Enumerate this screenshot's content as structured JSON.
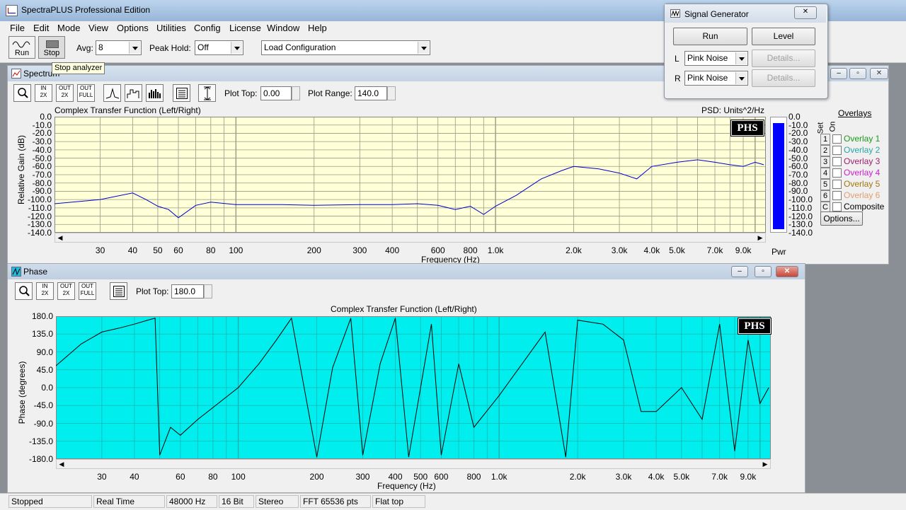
{
  "app": {
    "title": "SpectraPLUS Professional Edition"
  },
  "menu": [
    "File",
    "Edit",
    "Mode",
    "View",
    "Options",
    "Utilities",
    "Config",
    "License",
    "Window",
    "Help"
  ],
  "toolbar": {
    "run_label": "Run",
    "stop_label": "Stop",
    "avg_label": "Avg:",
    "avg_value": "8",
    "peak_hold_label": "Peak Hold:",
    "peak_hold_value": "Off",
    "load_config_value": "Load Configuration",
    "tooltip": "Stop analyzer"
  },
  "spectrum": {
    "title": "Spectrum",
    "plot_top_label": "Plot Top:",
    "plot_top_value": "0.00",
    "plot_range_label": "Plot Range:",
    "plot_range_value": "140.0",
    "chart_title": "Complex Transfer Function (Left/Right)",
    "psd_label": "PSD: Units^2/Hz",
    "y_axis_label": "Relative Gain (dB)",
    "x_axis_label": "Frequency (Hz)",
    "badge": "PHS",
    "pwr_label": "Pwr"
  },
  "overlays": {
    "header": "Overlays",
    "set_label": "Set",
    "on_label": "On",
    "items": [
      {
        "num": "1",
        "name": "Overlay 1",
        "color": "#1a9a1a"
      },
      {
        "num": "2",
        "name": "Overlay 2",
        "color": "#2aa7a7"
      },
      {
        "num": "3",
        "name": "Overlay 3",
        "color": "#a0206a"
      },
      {
        "num": "4",
        "name": "Overlay 4",
        "color": "#d020d0"
      },
      {
        "num": "5",
        "name": "Overlay 5",
        "color": "#a0780f"
      },
      {
        "num": "6",
        "name": "Overlay 6",
        "color": "#e0a070"
      },
      {
        "num": "C",
        "name": "Composite",
        "color": "#000000"
      }
    ],
    "options_label": "Options..."
  },
  "phase": {
    "title": "Phase",
    "plot_top_label": "Plot Top:",
    "plot_top_value": "180.0",
    "chart_title": "Complex Transfer Function (Left/Right)",
    "y_axis_label": "Phase (degrees)",
    "x_axis_label": "Frequency (Hz)",
    "badge": "PHS"
  },
  "signal_generator": {
    "title": "Signal Generator",
    "run_label": "Run",
    "level_label": "Level",
    "left_label": "L",
    "right_label": "R",
    "left_value": "Pink Noise",
    "right_value": "Pink Noise",
    "details_label": "Details..."
  },
  "status": {
    "state": "Stopped",
    "mode": "Real Time",
    "rate": "48000 Hz",
    "bits": "16 Bit",
    "channels": "Stereo",
    "fft": "FFT 65536 pts",
    "window": "Flat top"
  },
  "chart_data": [
    {
      "type": "line",
      "title": "Complex Transfer Function (Left/Right)",
      "xlabel": "Frequency (Hz)",
      "ylabel": "Relative Gain (dB)",
      "x_scale": "log",
      "xlim": [
        20,
        11000
      ],
      "ylim": [
        -140,
        0
      ],
      "x_ticks": [
        "30",
        "40",
        "50",
        "60",
        "80",
        "100",
        "200",
        "300",
        "400",
        "600",
        "800",
        "1.0k",
        "2.0k",
        "3.0k",
        "4.0k",
        "5.0k",
        "7.0k",
        "9.0k"
      ],
      "y_ticks": [
        "0.0",
        "-10.0",
        "-20.0",
        "-30.0",
        "-40.0",
        "-50.0",
        "-60.0",
        "-70.0",
        "-80.0",
        "-90.0",
        "-100.0",
        "-110.0",
        "-120.0",
        "-130.0",
        "-140.0"
      ],
      "series": [
        {
          "x": [
            20,
            30,
            40,
            45,
            50,
            55,
            60,
            70,
            80,
            100,
            150,
            200,
            300,
            400,
            500,
            600,
            700,
            800,
            900,
            1000,
            1200,
            1500,
            1800,
            2000,
            2500,
            3000,
            3500,
            4000,
            5000,
            6000,
            7000,
            8000,
            9000,
            10000,
            10800
          ],
          "y": [
            -105,
            -100,
            -92,
            -100,
            -108,
            -112,
            -122,
            -107,
            -103,
            -106,
            -106,
            -107,
            -106,
            -106,
            -105,
            -107,
            -112,
            -108,
            -118,
            -108,
            -95,
            -75,
            -65,
            -60,
            -63,
            -68,
            -75,
            -60,
            -55,
            -52,
            -55,
            -58,
            -60,
            -55,
            -58
          ]
        }
      ],
      "pwr_ylim": [
        -140,
        0
      ],
      "pwr_bar": 1.0,
      "grid": true
    },
    {
      "type": "line",
      "title": "Complex Transfer Function (Left/Right)",
      "xlabel": "Frequency (Hz)",
      "ylabel": "Phase (degrees)",
      "x_scale": "log",
      "xlim": [
        20,
        11000
      ],
      "ylim": [
        -180,
        180
      ],
      "x_ticks": [
        "30",
        "40",
        "60",
        "80",
        "100",
        "200",
        "300",
        "400",
        "500",
        "600",
        "800",
        "1.0k",
        "2.0k",
        "3.0k",
        "4.0k",
        "5.0k",
        "7.0k",
        "9.0k"
      ],
      "y_ticks": [
        "180.0",
        "135.0",
        "90.0",
        "45.0",
        "0.0",
        "-45.0",
        "-90.0",
        "-135.0",
        "-180.0"
      ],
      "series": [
        {
          "x": [
            20,
            25,
            30,
            35,
            40,
            45,
            48,
            50,
            55,
            60,
            70,
            80,
            100,
            120,
            140,
            160,
            200,
            230,
            270,
            300,
            350,
            400,
            450,
            500,
            550,
            600,
            700,
            800,
            1000,
            1500,
            1800,
            2000,
            2500,
            3000,
            3500,
            4000,
            5000,
            6000,
            7000,
            8000,
            9000,
            10000,
            10800
          ],
          "y": [
            55,
            110,
            140,
            150,
            160,
            170,
            175,
            -170,
            -100,
            -120,
            -80,
            -50,
            0,
            60,
            120,
            175,
            -175,
            50,
            175,
            -170,
            60,
            175,
            -175,
            0,
            160,
            -170,
            60,
            -100,
            -20,
            140,
            -175,
            170,
            160,
            120,
            -60,
            -60,
            0,
            -80,
            160,
            -160,
            120,
            -40,
            0
          ]
        }
      ],
      "grid": true
    }
  ]
}
